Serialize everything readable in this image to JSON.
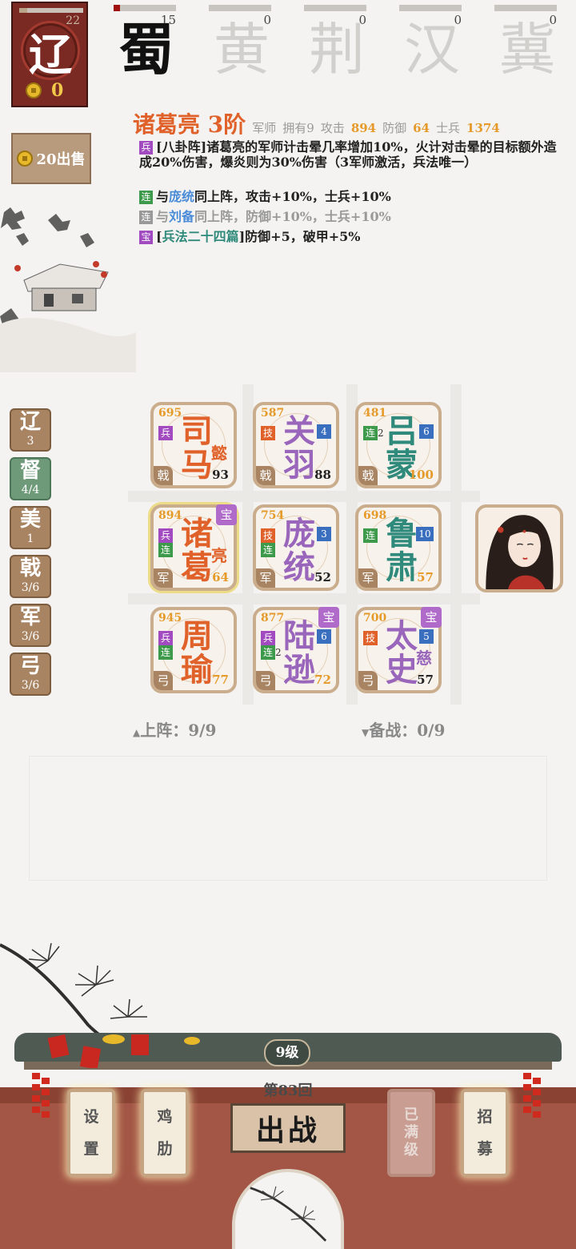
{
  "player": {
    "seal_char": "辽",
    "hp": "22",
    "coins": "0"
  },
  "factions": [
    {
      "char": "蜀",
      "score": "15",
      "state": "active"
    },
    {
      "char": "黄",
      "score": "0",
      "state": "inactive"
    },
    {
      "char": "荆",
      "score": "0",
      "state": "inactive"
    },
    {
      "char": "汉",
      "score": "0",
      "state": "inactive"
    },
    {
      "char": "冀",
      "score": "0",
      "state": "inactive"
    }
  ],
  "sell_button": {
    "label": "20出售"
  },
  "hero_info": {
    "name": "诸葛亮 3阶",
    "role": "军师",
    "owned": "拥有9",
    "attack_label": "攻击",
    "attack": "894",
    "defense_label": "防御",
    "defense": "64",
    "soldiers_label": "士兵",
    "soldiers": "1374",
    "skills": [
      {
        "tag": "兵",
        "text": "[八卦阵]诸葛亮的军师计击晕几率增加10%，火计对击晕的目标额外造成20%伤害，爆炎则为30%伤害（3军师激活，兵法唯一）"
      },
      {
        "tag": "连",
        "pre": "与",
        "partner": "庞统",
        "post": "同上阵，攻击+10%，士兵+10%"
      },
      {
        "tag": "连",
        "pre": "与",
        "partner": "刘备",
        "post": "同上阵，防御+10%，士兵+10%"
      },
      {
        "tag": "宝",
        "pre": "[",
        "partner": "兵法二十四篇",
        "post": "]防御+5，破甲+5%"
      }
    ]
  },
  "side_tabs": [
    {
      "label": "辽",
      "count": "3"
    },
    {
      "label": "督",
      "count": "4/4"
    },
    {
      "label": "美",
      "count": "1"
    },
    {
      "label": "戟",
      "count": "3/6"
    },
    {
      "label": "军",
      "count": "3/6"
    },
    {
      "label": "弓",
      "count": "3/6"
    }
  ],
  "cards": [
    {
      "name1": "司",
      "name2": "马",
      "sub": "懿",
      "power": "695",
      "level": "93",
      "type": "戟"
    },
    {
      "name1": "关",
      "name2": "羽",
      "sub": "",
      "power": "587",
      "level": "88",
      "type": "戟",
      "badge": "4"
    },
    {
      "name1": "吕",
      "name2": "蒙",
      "sub": "",
      "power": "481",
      "level": "100",
      "type": "戟",
      "badge": "6",
      "link2": "2"
    },
    {
      "name1": "诸",
      "name2": "葛",
      "sub": "亮",
      "power": "894",
      "level": "64",
      "type": "军",
      "bao": "宝"
    },
    {
      "name1": "庞",
      "name2": "统",
      "sub": "",
      "power": "754",
      "level": "52",
      "type": "军",
      "badge": "3"
    },
    {
      "name1": "鲁",
      "name2": "肃",
      "sub": "",
      "power": "698",
      "level": "57",
      "type": "军",
      "badge": "10"
    },
    {
      "name1": "周",
      "name2": "瑜",
      "sub": "",
      "power": "945",
      "level": "77",
      "type": "弓"
    },
    {
      "name1": "陆",
      "name2": "逊",
      "sub": "",
      "power": "877",
      "level": "72",
      "type": "弓",
      "badge": "6",
      "bao": "宝",
      "link2": "2"
    },
    {
      "name1": "太",
      "name2": "史",
      "sub": "慈",
      "power": "700",
      "level": "57",
      "type": "弓",
      "badge": "5",
      "bao": "宝"
    }
  ],
  "tags": {
    "bing": "兵",
    "ji": "技",
    "lian": "连"
  },
  "status": {
    "deployed": "上阵：9/9",
    "reserve": "备战：0/9"
  },
  "bottom": {
    "level": "9级",
    "round": "第83回",
    "battle": "出战",
    "settings": [
      "设",
      "置"
    ],
    "chicken": [
      "鸡",
      "肋"
    ],
    "maxed": [
      "已",
      "满",
      "级"
    ],
    "recruit": [
      "招",
      "募"
    ]
  }
}
